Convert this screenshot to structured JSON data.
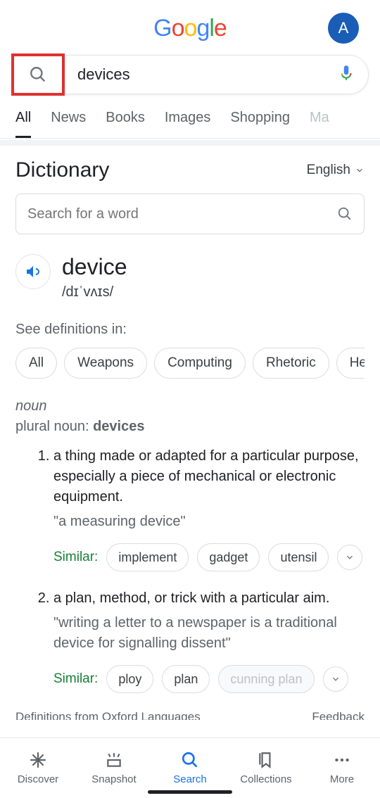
{
  "header": {
    "avatar_initial": "A"
  },
  "search": {
    "query": "devices"
  },
  "tabs": [
    "All",
    "News",
    "Books",
    "Images",
    "Shopping",
    "Ma"
  ],
  "dictionary": {
    "title": "Dictionary",
    "language": "English",
    "search_placeholder": "Search for a word",
    "word": "device",
    "pronunciation": "/dɪˈvʌɪs/",
    "see_definitions_label": "See definitions in:",
    "categories": [
      "All",
      "Weapons",
      "Computing",
      "Rhetoric",
      "Heraldry"
    ],
    "part_of_speech": "noun",
    "plural_label": "plural noun:",
    "plural_form": "devices",
    "definitions": [
      {
        "text": "a thing made or adapted for a particular purpose, especially a piece of mechanical or electronic equipment.",
        "example": "\"a measuring device\"",
        "similar_label": "Similar:",
        "similar": [
          {
            "w": "implement",
            "faded": false
          },
          {
            "w": "gadget",
            "faded": false
          },
          {
            "w": "utensil",
            "faded": false
          }
        ]
      },
      {
        "text": "a plan, method, or trick with a particular aim.",
        "example": "\"writing a letter to a newspaper is a traditional device for signalling dissent\"",
        "similar_label": "Similar:",
        "similar": [
          {
            "w": "ploy",
            "faded": false
          },
          {
            "w": "plan",
            "faded": false
          },
          {
            "w": "cunning plan",
            "faded": true
          }
        ]
      }
    ],
    "source_left": "Definitions from Oxford Languages",
    "source_right": "Feedback"
  },
  "nav": {
    "discover": "Discover",
    "snapshot": "Snapshot",
    "search": "Search",
    "collections": "Collections",
    "more": "More"
  }
}
